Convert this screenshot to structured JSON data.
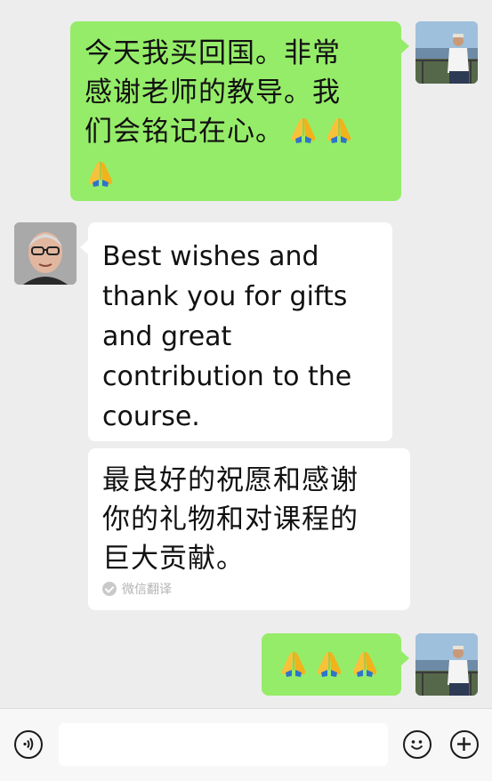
{
  "messages": [
    {
      "direction": "outgoing",
      "sender_avatar": "photo-man-white-shirt-hat",
      "text": "今天我买回国。非常\n感谢老师的教导。我\n们会铭记在心。",
      "emoji": "folded-hands-icon ×3"
    },
    {
      "direction": "incoming",
      "sender_avatar": "photo-older-man-glasses",
      "text": "Best wishes and\nthank you for gifts\nand great\ncontribution to the\ncourse."
    },
    {
      "direction": "incoming",
      "type": "translation",
      "text": "最良好的祝愿和感谢\n你的礼物和对课程的\n巨大贡献。",
      "translation_label": "微信翻译"
    },
    {
      "direction": "outgoing",
      "sender_avatar": "photo-man-white-shirt-hat",
      "emoji": "folded-hands-icon ×3"
    }
  ],
  "input_bar": {
    "voice_icon": "voice-icon",
    "text_value": "",
    "emoji_icon": "emoji-icon",
    "plus_icon": "plus-icon"
  },
  "colors": {
    "chat_background": "#ededed",
    "outgoing_bubble": "#95ec69",
    "incoming_bubble": "#ffffff",
    "input_bar_background": "#f7f7f7"
  }
}
